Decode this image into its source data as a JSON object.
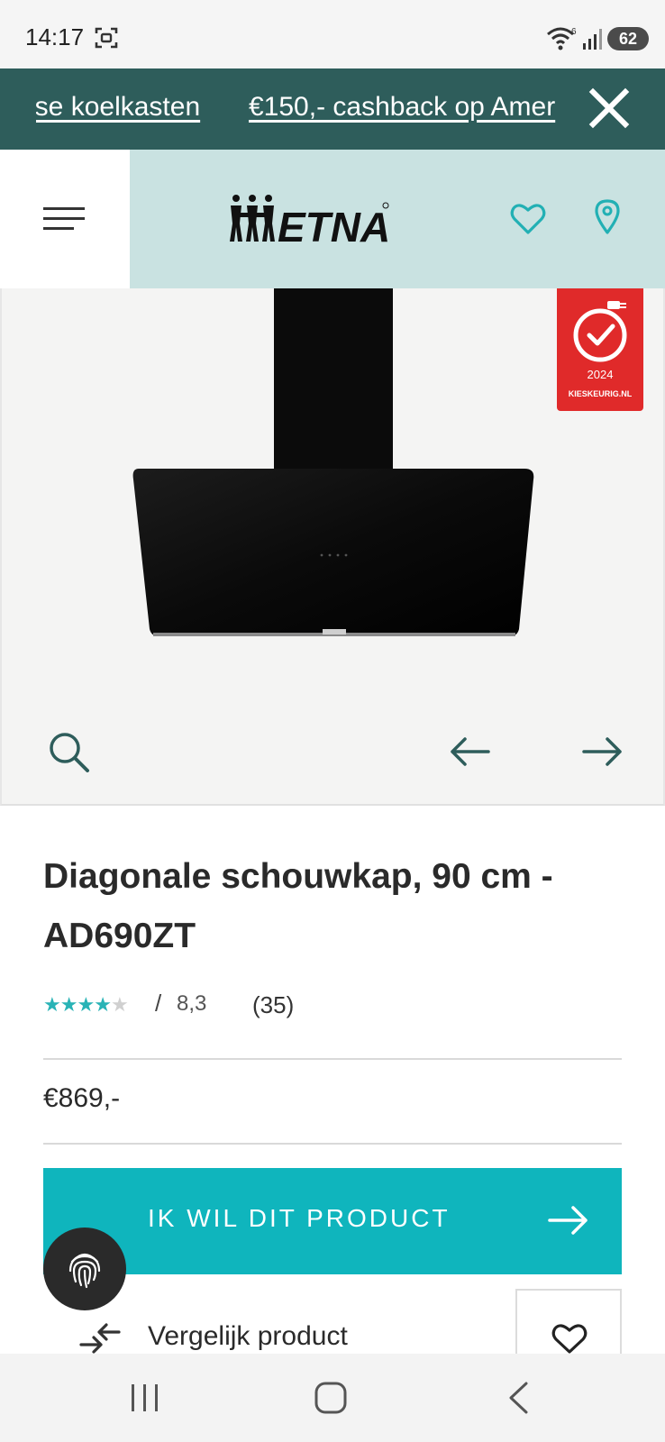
{
  "status_bar": {
    "time": "14:17",
    "battery": "62",
    "icons": [
      "screenshot-icon",
      "wifi-icon",
      "signal-icon",
      "battery-icon"
    ]
  },
  "promo": {
    "items": [
      "nse koelkasten",
      "€150,- cashback op Amer"
    ],
    "close_icon": "close-icon",
    "background": "#2e5d5b"
  },
  "header": {
    "logo_text": "ETNA",
    "menu_icon": "hamburger-menu-icon",
    "wishlist_icon": "heart-icon",
    "store_icon": "location-pin-icon",
    "background": "#c9e2e1"
  },
  "gallery": {
    "award": {
      "year": "2024",
      "site": "KIESKEURIG.NL"
    },
    "search_icon": "zoom-icon",
    "prev_icon": "arrow-left-icon",
    "next_icon": "arrow-right-icon"
  },
  "product": {
    "title": "Diagonale schouwkap, 90 cm - AD690ZT",
    "rating_separator": "/",
    "rating_score": "8,3",
    "rating_count": "(35)",
    "rating_stars": 4,
    "rating_stars_max": 5,
    "price": "€869,-"
  },
  "cta": {
    "label": "IK WIL DIT PRODUCT",
    "color": "#0fb5bd"
  },
  "compare": {
    "label": "Vergelijk product"
  },
  "nav_bar": {
    "icons": [
      "recent-apps-icon",
      "home-icon",
      "back-icon"
    ]
  }
}
